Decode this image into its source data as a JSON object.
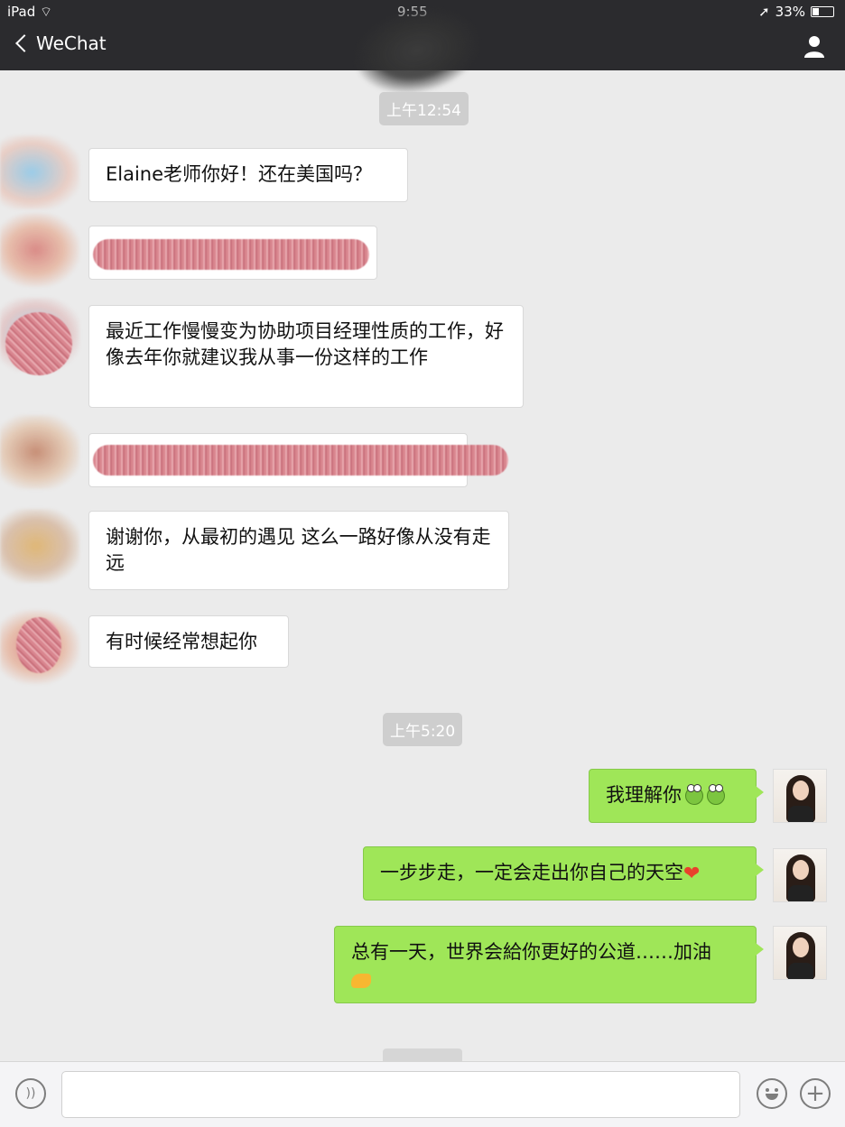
{
  "status_bar": {
    "device": "iPad",
    "time": "9:55",
    "battery": "33%",
    "battery_level": 0.33
  },
  "nav": {
    "back_label": "WeChat"
  },
  "timestamps": [
    "上午12:54",
    "上午5:20"
  ],
  "incoming": [
    {
      "text": "Elaine老师你好！还在美国吗？",
      "redacted": false
    },
    {
      "text": "",
      "redacted": true
    },
    {
      "text": "最近工作慢慢变为协助项目经理性质的工作，好像去年你就建议我从事一份这样的工作",
      "redacted": false
    },
    {
      "text": "",
      "redacted": true
    },
    {
      "text": "谢谢你，从最初的遇见  这么一路好像从没有走远",
      "redacted": false
    },
    {
      "text": "有时候经常想起你",
      "redacted": false
    }
  ],
  "outgoing": [
    {
      "text": "我理解你",
      "emoji": [
        "frog",
        "frog"
      ]
    },
    {
      "text": "一步步走，一定会走出你自己的天空",
      "emoji": [
        "heart"
      ]
    },
    {
      "text": "总有一天，世界会給你更好的公道……加油",
      "emoji": [
        "flexed-arm"
      ]
    }
  ],
  "icons": {
    "back": "chevron-left-icon",
    "profile": "person-icon",
    "voice": "voice-icon",
    "emoji": "smiley-icon",
    "plus": "plus-icon"
  }
}
